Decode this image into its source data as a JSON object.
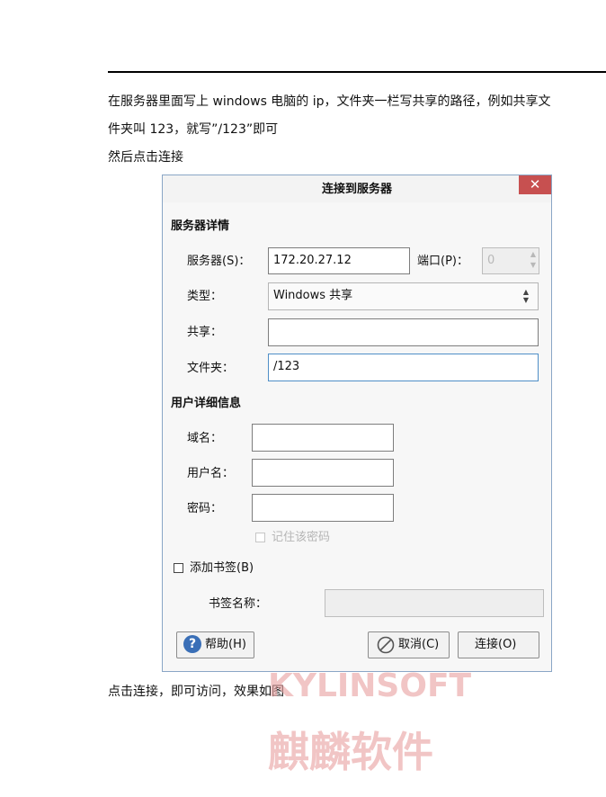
{
  "document": {
    "instruction_line1": "在服务器里面写上 windows 电脑的 ip，文件夹一栏写共享的路径，例如共享文",
    "instruction_line2": "件夹叫 123，就写”/123”即可",
    "instruction_line3": "然后点击连接",
    "result_line": "点击连接，即可访问，效果如图"
  },
  "dialog": {
    "title": "连接到服务器",
    "close_glyph": "✕",
    "server_details_heading": "服务器详情",
    "server_label": "服务器(S)：",
    "server_value": "172.20.27.12",
    "port_label": "端口(P)：",
    "port_value": "0",
    "type_label": "类型：",
    "type_value": "Windows 共享",
    "share_label": "共享：",
    "share_value": "",
    "folder_label": "文件夹：",
    "folder_value": "/123",
    "user_details_heading": "用户详细信息",
    "domain_label": "域名：",
    "domain_value": "",
    "username_label": "用户名：",
    "username_value": "",
    "password_label": "密码：",
    "password_value": "",
    "remember_password_label": "记住该密码",
    "add_bookmark_label": "添加书签(B)",
    "bookmark_name_label": "书签名称：",
    "bookmark_name_value": "",
    "help_button": "帮助(H)",
    "cancel_button": "取消(C)",
    "connect_button": "连接(O)"
  },
  "watermark": {
    "latin": "KYLINSOFT",
    "chinese": "麒麟软件"
  }
}
